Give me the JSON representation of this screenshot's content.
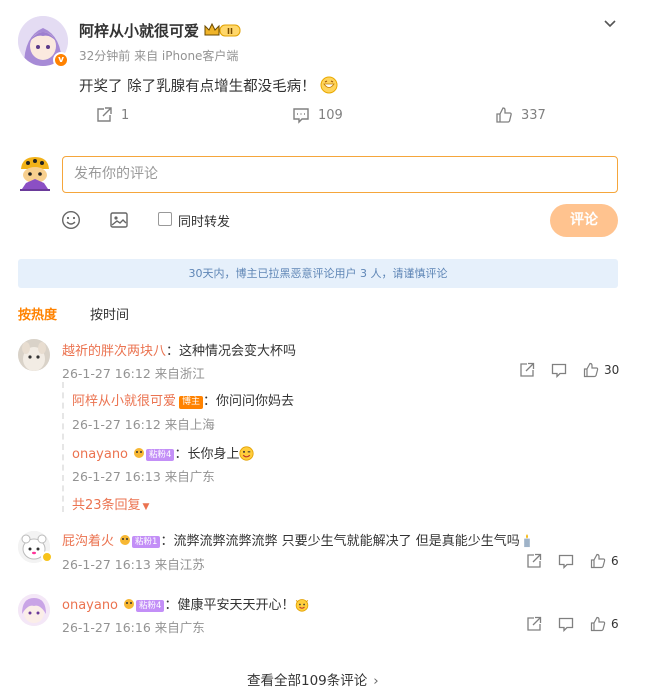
{
  "post": {
    "author": "阿梓从小就很可爱",
    "time": "32分钟前",
    "source": "来自 iPhone客户端",
    "text": "开奖了 除了乳腺有点增生都没毛病！",
    "repost_count": "1",
    "comment_count": "109",
    "like_count": "337"
  },
  "composer": {
    "placeholder": "发布你的评论",
    "repost_label": "同时转发",
    "submit_label": "评论"
  },
  "notice": "30天内，博主已拉黑恶意评论用户 3 人，请谨慎评论",
  "sort": {
    "hot": "按热度",
    "time": "按时间"
  },
  "comments": [
    {
      "user": "越祈的胖次两块八",
      "text": "：这种情况会变大杯吗",
      "meta": "26-1-27 16:12 来自浙江",
      "likes": "30",
      "replies": [
        {
          "user": "阿梓从小就很可爱",
          "tag": "博主",
          "text": "：你问问你妈去",
          "meta": "26-1-27 16:12 来自上海"
        },
        {
          "user": "onayano",
          "tag": "粘粉4",
          "text": "：长你身上",
          "meta": "26-1-27 16:13 来自广东"
        }
      ],
      "more_replies": "共23条回复"
    },
    {
      "user": "屁沟着火",
      "tag": "粘粉1",
      "text": "：流弊流弊流弊流弊 只要少生气就能解决了 但是真能少生气吗",
      "meta": "26-1-27 16:13 来自江苏",
      "likes": "6"
    },
    {
      "user": "onayano",
      "tag": "粘粉4",
      "text": "：健康平安天天开心！",
      "meta": "26-1-27 16:16 来自广东",
      "likes": "6"
    }
  ],
  "view_all": "查看全部109条评论",
  "colors": {
    "accent": "#ff8200",
    "username": "#eb7350",
    "notice_bg": "#e6f0fb",
    "notice_text": "#5f86b6"
  }
}
